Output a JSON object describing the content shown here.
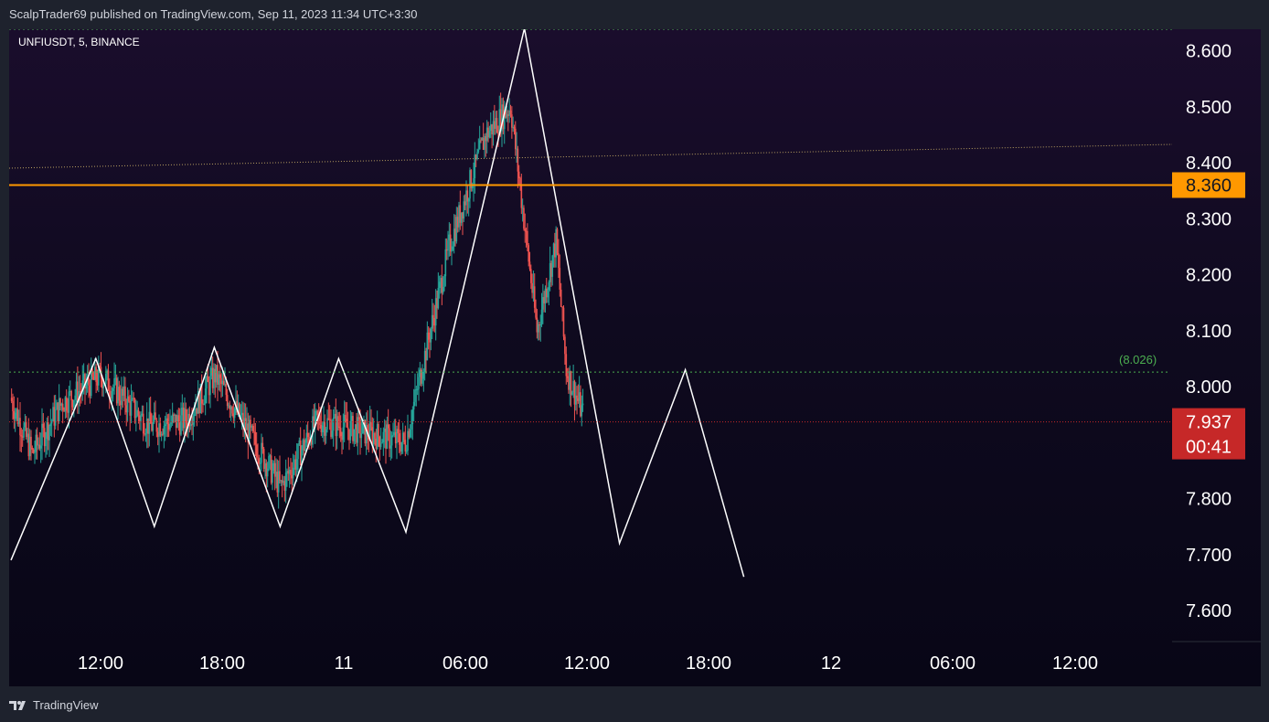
{
  "header": {
    "publish_line": "ScalpTrader69 published on TradingView.com, Sep 11, 2023 11:34 UTC+3:30"
  },
  "footer": {
    "brand": "TradingView"
  },
  "chart_data": {
    "type": "candlestick",
    "symbol_line": "UNFIUSDT, 5, BINANCE",
    "y_ticks": [
      "8.600",
      "8.500",
      "8.400",
      "8.300",
      "8.200",
      "8.100",
      "8.000",
      "7.800",
      "7.700",
      "7.600"
    ],
    "x_ticks": [
      "12:00",
      "18:00",
      "11",
      "06:00",
      "12:00",
      "18:00",
      "12",
      "06:00",
      "12:00"
    ],
    "ylim": [
      7.56,
      8.64
    ],
    "horizontal_level": {
      "value": 8.36,
      "label": "8.360",
      "color": "#ff9800"
    },
    "dotted_level": {
      "value": 8.026,
      "label": "(8.026)",
      "color": "#4caf50"
    },
    "last_price": {
      "value": 7.937,
      "label": "7.937",
      "countdown": "00:41",
      "color": "#c62828"
    },
    "up_color": "#26a69a",
    "down_color": "#ef5350",
    "zigzag_path": [
      {
        "t": 0.0,
        "price": 7.69
      },
      {
        "t": 5.8,
        "price": 8.05
      },
      {
        "t": 9.8,
        "price": 7.75
      },
      {
        "t": 13.9,
        "price": 8.07
      },
      {
        "t": 18.4,
        "price": 7.75
      },
      {
        "t": 22.4,
        "price": 8.05
      },
      {
        "t": 27.0,
        "price": 7.74
      },
      {
        "t": 35.1,
        "price": 8.64
      },
      {
        "t": 41.6,
        "price": 7.72
      },
      {
        "t": 46.1,
        "price": 8.03
      },
      {
        "t": 50.1,
        "price": 7.66
      }
    ],
    "candle_sessions": [
      {
        "t0": 0.0,
        "t1": 1.5,
        "p0": 7.98,
        "p1": 7.88
      },
      {
        "t0": 1.5,
        "t1": 3.5,
        "p0": 7.88,
        "p1": 7.97
      },
      {
        "t0": 3.5,
        "t1": 6.2,
        "p0": 7.97,
        "p1": 8.02
      },
      {
        "t0": 6.2,
        "t1": 9.5,
        "p0": 8.02,
        "p1": 7.93
      },
      {
        "t0": 9.5,
        "t1": 12.0,
        "p0": 7.93,
        "p1": 7.94
      },
      {
        "t0": 12.0,
        "t1": 14.0,
        "p0": 7.94,
        "p1": 8.02
      },
      {
        "t0": 14.0,
        "t1": 18.5,
        "p0": 8.02,
        "p1": 7.82
      },
      {
        "t0": 18.5,
        "t1": 21.0,
        "p0": 7.82,
        "p1": 7.94
      },
      {
        "t0": 21.0,
        "t1": 27.0,
        "p0": 7.94,
        "p1": 7.9
      },
      {
        "t0": 27.0,
        "t1": 30.0,
        "p0": 7.9,
        "p1": 8.25
      },
      {
        "t0": 30.0,
        "t1": 32.5,
        "p0": 8.25,
        "p1": 8.45
      },
      {
        "t0": 32.5,
        "t1": 34.2,
        "p0": 8.45,
        "p1": 8.5
      },
      {
        "t0": 34.2,
        "t1": 36.0,
        "p0": 8.5,
        "p1": 8.1
      },
      {
        "t0": 36.0,
        "t1": 37.3,
        "p0": 8.1,
        "p1": 8.26
      },
      {
        "t0": 37.3,
        "t1": 38.0,
        "p0": 8.26,
        "p1": 8.03
      },
      {
        "t0": 38.0,
        "t1": 39.3,
        "p0": 8.03,
        "p1": 7.94
      }
    ]
  }
}
